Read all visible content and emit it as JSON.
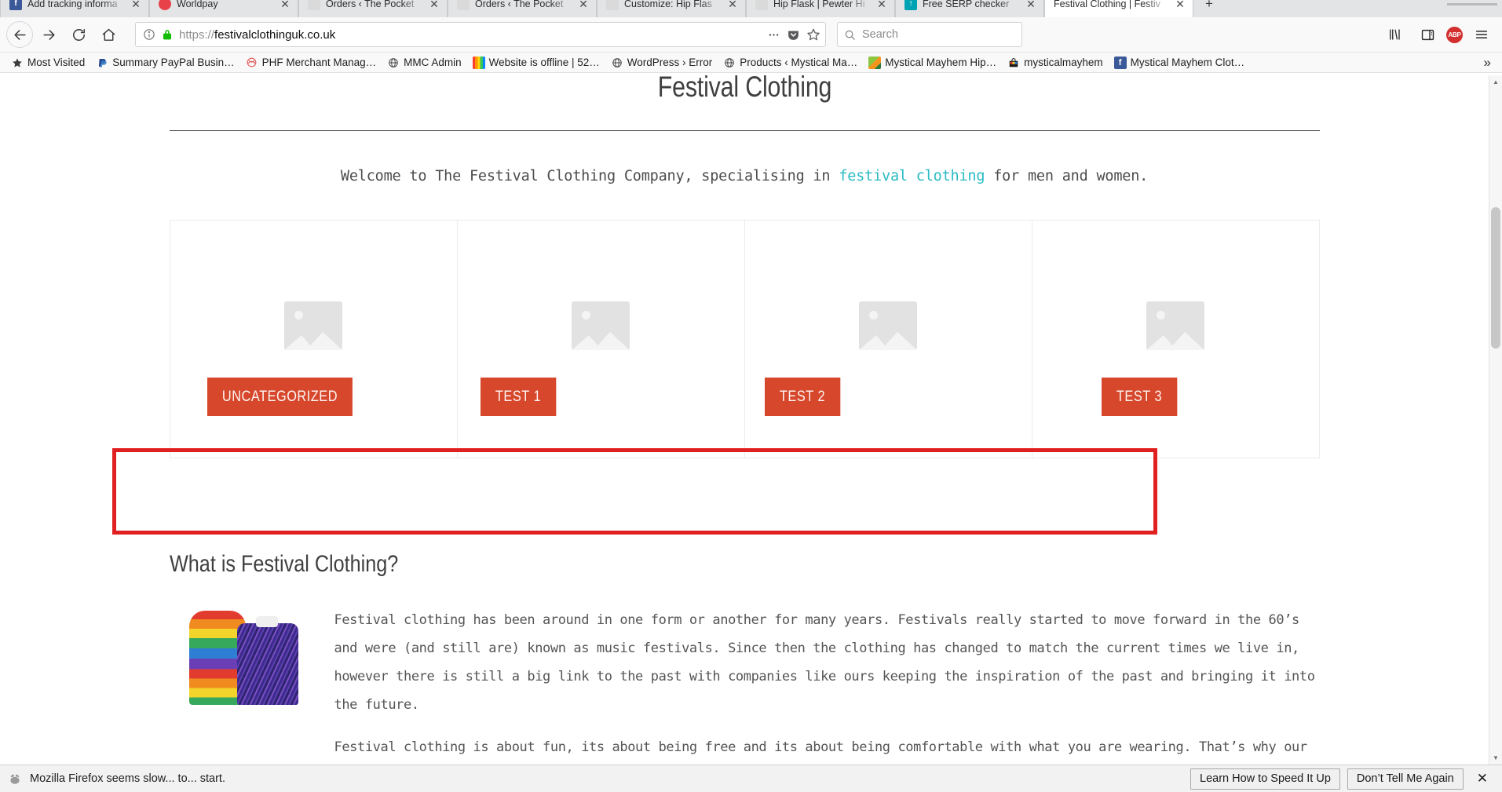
{
  "browser": {
    "tabs": [
      {
        "title": "Add tracking informa",
        "favicon": "facebook-icon",
        "favicon_color": "#3b5998",
        "favicon_glyph": "f",
        "active": false
      },
      {
        "title": "Worldpay",
        "favicon": "worldpay-icon",
        "favicon_color": "#e8414a",
        "favicon_glyph": "●",
        "active": false
      },
      {
        "title": "Orders ‹ The Pocket",
        "favicon": "page-icon",
        "favicon_color": "#d9d9d9",
        "favicon_glyph": "",
        "active": false
      },
      {
        "title": "Orders ‹ The Pocket",
        "favicon": "page-icon",
        "favicon_color": "#d9d9d9",
        "favicon_glyph": "",
        "active": false
      },
      {
        "title": "Customize: Hip Flas",
        "favicon": "page-icon",
        "favicon_color": "#d9d9d9",
        "favicon_glyph": "",
        "active": false
      },
      {
        "title": "Hip Flask | Pewter Hi",
        "favicon": "page-icon",
        "favicon_color": "#d9d9d9",
        "favicon_glyph": "",
        "active": false
      },
      {
        "title": "Free SERP checker",
        "favicon": "serp-icon",
        "favicon_color": "#00a3b4",
        "favicon_glyph": "↑",
        "active": false
      },
      {
        "title": "Festival Clothing | Festiv",
        "favicon": "festival-icon",
        "favicon_color": "#ffffff",
        "favicon_glyph": "",
        "active": true
      }
    ],
    "new_tab_label": "+",
    "nav": {
      "back_label": "Back",
      "forward_label": "Forward",
      "reload_label": "Reload",
      "home_label": "Home"
    },
    "urlbar": {
      "scheme": "https://",
      "host": "festivalclothinguk.co.uk",
      "info_icon": "page-info-icon",
      "lock_icon": "padlock-icon",
      "page_actions_icon": "ellipsis-icon",
      "pocket_icon": "pocket-icon",
      "bookmark_icon": "star-icon"
    },
    "search": {
      "placeholder": "Search",
      "icon": "search-icon"
    },
    "toolbar_right": {
      "library_label": "Library",
      "sidebar_label": "Sidebars",
      "adblock_label": "ABP",
      "menu_label": "Open menu"
    },
    "bookmarks": [
      {
        "label": "Most Visited",
        "icon": "star-bookmark-icon",
        "color": "#333333"
      },
      {
        "label": "Summary PayPal Busin…",
        "icon": "paypal-icon",
        "color": "#1e3a8a"
      },
      {
        "label": "PHF Merchant Manag…",
        "icon": "phf-icon",
        "color": "#e05a5a"
      },
      {
        "label": "MMC Admin",
        "icon": "globe-icon",
        "color": "#444444"
      },
      {
        "label": "Website is offline | 52…",
        "icon": "rainbow-icon",
        "color": "#ff6a00"
      },
      {
        "label": "WordPress › Error",
        "icon": "globe-icon",
        "color": "#444444"
      },
      {
        "label": "Products ‹ Mystical Ma…",
        "icon": "globe-icon",
        "color": "#444444"
      },
      {
        "label": "Mystical Mayhem Hip…",
        "icon": "image-icon",
        "color": "#4c9a2a"
      },
      {
        "label": "mysticalmayhem",
        "icon": "shop-bag-icon",
        "color": "#222222"
      },
      {
        "label": "Mystical Mayhem Clot…",
        "icon": "facebook-icon",
        "color": "#3b5998"
      }
    ],
    "bookmarks_overflow": "»"
  },
  "page": {
    "site_title": "Festival Clothing",
    "welcome": {
      "before": "Welcome to The Festival Clothing Company, specialising in ",
      "link": "festival clothing",
      "after": " for men and women."
    },
    "categories": [
      {
        "label": "Uncategorized",
        "image_alt": "placeholder-image"
      },
      {
        "label": "Test 1",
        "image_alt": "placeholder-image"
      },
      {
        "label": "Test 2",
        "image_alt": "placeholder-image"
      },
      {
        "label": "Test 3",
        "image_alt": "placeholder-image"
      }
    ],
    "section_title": "What is Festival Clothing?",
    "paragraphs": [
      "Festival clothing has been around in one form or another for many years.  Festivals really started to move forward in the 60’s and were (and still are) known as music festivals.  Since then the clothing has changed to match the current times we live in, however there is still a big link to the past with companies like ours keeping the inspiration of the past and bringing it into the future.",
      "Festival clothing is about fun, its about being free and its about being comfortable with what you are wearing. That’s why our clothing range is handmade, unique and most of the time bright, colourful and fun to wear either in everyday life"
    ],
    "image_alt": "rainbow-jumpers-photo",
    "accent_color": "#d6472c",
    "link_color": "#2bbbc4",
    "highlight_box_color": "#e02020"
  },
  "notification": {
    "icon": "firefox-slow-icon",
    "message": "Mozilla Firefox seems slow... to... start.",
    "primary_button": "Learn How to Speed It Up",
    "primary_accesskey": "L",
    "secondary_button": "Don’t Tell Me Again",
    "secondary_accesskey": "A",
    "close_label": "✕"
  }
}
